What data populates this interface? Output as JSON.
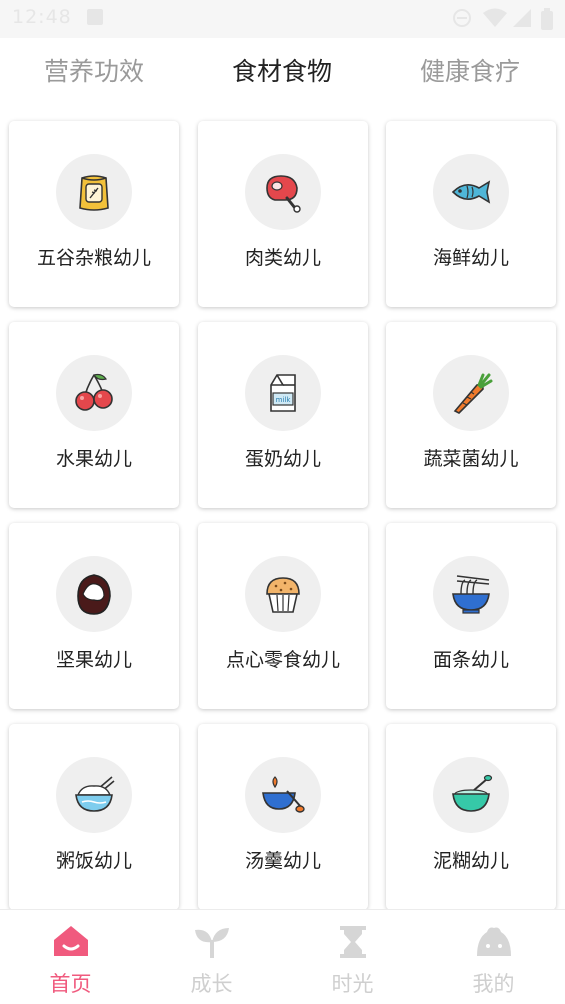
{
  "status_bar": {
    "time": "12:48"
  },
  "tabs": [
    {
      "label": "营养功效",
      "active": false
    },
    {
      "label": "食材食物",
      "active": true
    },
    {
      "label": "健康食疗",
      "active": false
    }
  ],
  "categories": [
    {
      "label": "五谷杂粮幼儿",
      "icon": "grain-bag-icon"
    },
    {
      "label": "肉类幼儿",
      "icon": "meat-icon"
    },
    {
      "label": "海鲜幼儿",
      "icon": "fish-icon"
    },
    {
      "label": "水果幼儿",
      "icon": "cherry-icon"
    },
    {
      "label": "蛋奶幼儿",
      "icon": "milk-carton-icon"
    },
    {
      "label": "蔬菜菌幼儿",
      "icon": "carrot-icon"
    },
    {
      "label": "坚果幼儿",
      "icon": "nut-icon"
    },
    {
      "label": "点心零食幼儿",
      "icon": "muffin-icon"
    },
    {
      "label": "面条幼儿",
      "icon": "noodle-bowl-icon"
    },
    {
      "label": "粥饭幼儿",
      "icon": "rice-bowl-icon"
    },
    {
      "label": "汤羹幼儿",
      "icon": "soup-pot-icon"
    },
    {
      "label": "泥糊幼儿",
      "icon": "puree-bowl-icon"
    }
  ],
  "icon_text": {
    "milk": "milk"
  },
  "bottom_nav": [
    {
      "label": "首页",
      "icon": "home-icon",
      "active": true
    },
    {
      "label": "成长",
      "icon": "sprout-icon",
      "active": false
    },
    {
      "label": "时光",
      "icon": "hourglass-icon",
      "active": false
    },
    {
      "label": "我的",
      "icon": "profile-icon",
      "active": false
    }
  ],
  "colors": {
    "accent": "#f05a7e",
    "inactive_nav": "#cfcfcf",
    "card_bg": "#ffffff",
    "icon_circle": "#efefef"
  }
}
